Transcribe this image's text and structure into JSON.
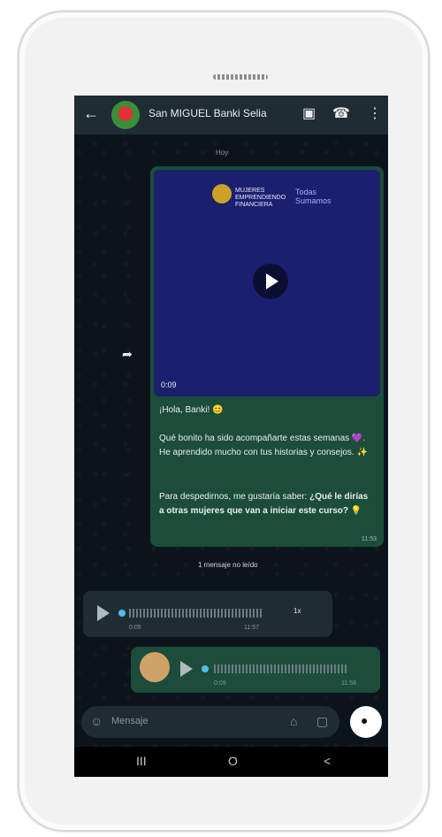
{
  "chat": {
    "title": "San MIGUEL Banki Selia",
    "day_chip": "Hoy"
  },
  "video": {
    "logo_text": "MUJERES EMPRENDIENDO FINANCIERA",
    "tagline": "Todas Sumamos",
    "duration": "0:09"
  },
  "message": {
    "greeting": "¡Hola, Banki! 😊",
    "p1": "Qué bonito ha sido acompañarte estas semanas 💜. He aprendido mucho con tus historias y consejos. ✨",
    "p2_start": "Para despedirnos, me gustaría saber: ",
    "p2_bold": "¿Qué le dirías a otras mujeres que van a iniciar este curso? 💡",
    "time": "11:53"
  },
  "unread_label": "1 mensaje no leído",
  "voice_in": {
    "duration": "0:05",
    "time": "11:57",
    "speed": "1x"
  },
  "voice_out": {
    "duration": "0:09",
    "time": "11:58"
  },
  "composer": {
    "placeholder": "Mensaje"
  },
  "icons": {
    "back": "back-arrow-icon",
    "gallery": "gallery-icon",
    "call": "call-add-icon",
    "menu": "more-vert-icon",
    "sticker": "sticker-icon",
    "attach": "attach-icon",
    "camera": "camera-icon",
    "mic": "mic-icon",
    "forward": "forward-icon"
  },
  "nav": {
    "recents": "III",
    "home": "O",
    "back": "<"
  }
}
